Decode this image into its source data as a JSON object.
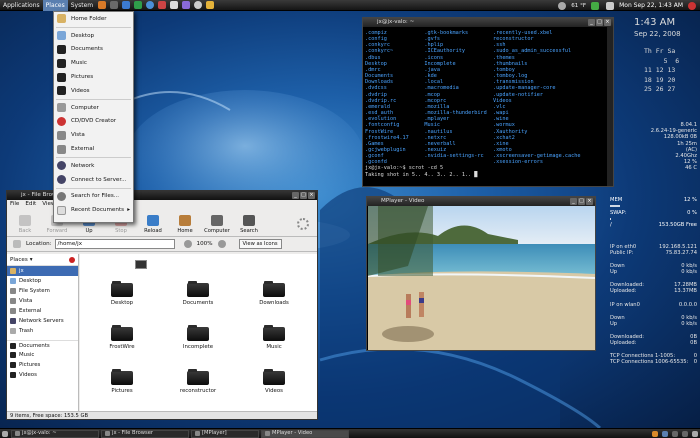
{
  "top_panel": {
    "menus": [
      "Applications",
      "Places",
      "System"
    ],
    "clock": "Mon Sep 22, 1:43 AM",
    "temp": "61 °F"
  },
  "places_menu": {
    "items": [
      "Home Folder",
      "Desktop",
      "Documents",
      "Music",
      "Pictures",
      "Videos",
      "Computer",
      "CD/DVD Creator",
      "Vista",
      "External",
      "Network",
      "Connect to Server...",
      "Search for Files...",
      "Recent Documents"
    ]
  },
  "terminal": {
    "title": "jx@jx-valo: ~",
    "col1": [
      ".compiz",
      ".config",
      ".conkyrc",
      ".conkyrc~",
      ".dbus",
      "Desktop",
      ".dmrc",
      "Documents",
      "Downloads",
      ".dvdcss",
      ".dvdrip",
      ".dvdrip.rc",
      ".emerald",
      ".esd_auth",
      ".evolution",
      ".fontconfig",
      "FrostWire",
      ".frostwire4.17",
      ".Games",
      ".gcjwebplugin",
      ".gconf",
      ".gconfd"
    ],
    "col2": [
      ".gtk-bookmarks",
      ".gvfs",
      ".hplip",
      ".ICEauthority",
      ".icons",
      "Incomplete",
      ".java",
      ".kde",
      ".local",
      ".macromedia",
      ".mcop",
      ".mcoprc",
      ".mozilla",
      ".mozilla-thunderbird",
      ".mplayer",
      "Music",
      ".nautilus",
      ".netxrc",
      ".neverball",
      ".nexuiz",
      ".nvidia-settings-rc"
    ],
    "col3": [
      ".recently-used.xbel",
      "reconstructor",
      ".ssh",
      ".sudo_as_admin_successful",
      ".themes",
      ".thumbnails",
      ".tomboy",
      ".tomboy.log",
      ".transmission",
      ".update-manager-core",
      ".update-notifier",
      "Videos",
      ".vlc",
      ".wapi",
      ".wine",
      ".wormux",
      ".Xauthority",
      ".xchat2",
      ".xine",
      ".xmoto",
      ".xscreensaver-getimage.cache",
      ".xsession-errors"
    ],
    "prompt": "jx@jx-valo:~$ scrot -cd 5",
    "output": "Taking shot in 5.. 4.. 3.. 2.. 1.. "
  },
  "conky": {
    "time": "1:43 AM",
    "date": "Sep 22, 2008",
    "calendar": "Th Fr Sa\n     5  6\n11 12 13\n18 19 20\n25 26 27",
    "sys": [
      [
        "",
        "8.04.1"
      ],
      [
        "",
        "2.6.24-19-generic"
      ],
      [
        "",
        "128.00kB 0B"
      ],
      [
        "",
        "1h 25m"
      ],
      [
        "",
        "(AC)"
      ],
      [
        "",
        "2.40Ghz"
      ],
      [
        "",
        "12 %"
      ],
      [
        "",
        "46 C"
      ]
    ],
    "mem": {
      "label": "MEM",
      "value": "12 %",
      "pct": 12
    },
    "swap": {
      "label": "SWAP:",
      "value": "0 %",
      "pct": 0
    },
    "disk": {
      "label": "/",
      "value": "153.50GB Free"
    },
    "net": [
      [
        "IP on eth0",
        "192.168.5.121"
      ],
      [
        "Public IP:",
        "75.83.27.74"
      ],
      [
        "Down",
        "0 kb/s"
      ],
      [
        "Up",
        "0 kb/s"
      ],
      [
        "Downloaded:",
        "17.28MB"
      ],
      [
        "Uploaded:",
        "13.37MB"
      ],
      [
        "IP on wlan0",
        "0.0.0.0"
      ],
      [
        "Down",
        "0 kb/s"
      ],
      [
        "Up",
        "0 kb/s"
      ],
      [
        "Downloaded:",
        "0B"
      ],
      [
        "Uploaded:",
        "0B"
      ],
      [
        "TCP Connections 1-1005:",
        "0"
      ],
      [
        "TCP Connections 1006-65535:",
        "0"
      ]
    ]
  },
  "file_browser": {
    "title": "jx - File Browser",
    "menu": [
      "File",
      "Edit",
      "View",
      "Go",
      "Bookmarks",
      "Help"
    ],
    "toolbar": [
      "Back",
      "Forward",
      "Up",
      "Stop",
      "Reload",
      "Home",
      "Computer",
      "Search"
    ],
    "location_label": "Location:",
    "location": "/home/jx",
    "zoom": "100%",
    "view": "View as Icons",
    "sidebar_title": "Places",
    "sidebar": [
      "jx",
      "Desktop",
      "File System",
      "Vista",
      "External",
      "Network Servers",
      "Trash",
      "Documents",
      "Music",
      "Pictures",
      "Videos"
    ],
    "folders": [
      "Desktop",
      "Documents",
      "Downloads",
      "FrostWire",
      "Incomplete",
      "Music",
      "Pictures",
      "reconstructor",
      "Videos"
    ],
    "status": "9 items, Free space: 153.5 GB"
  },
  "mplayer": {
    "title": "MPlayer - Video"
  },
  "taskbar": [
    "jx@jx-valo: ~",
    "jx - File Browser",
    "[MPlayer]",
    "MPlayer - Video"
  ]
}
